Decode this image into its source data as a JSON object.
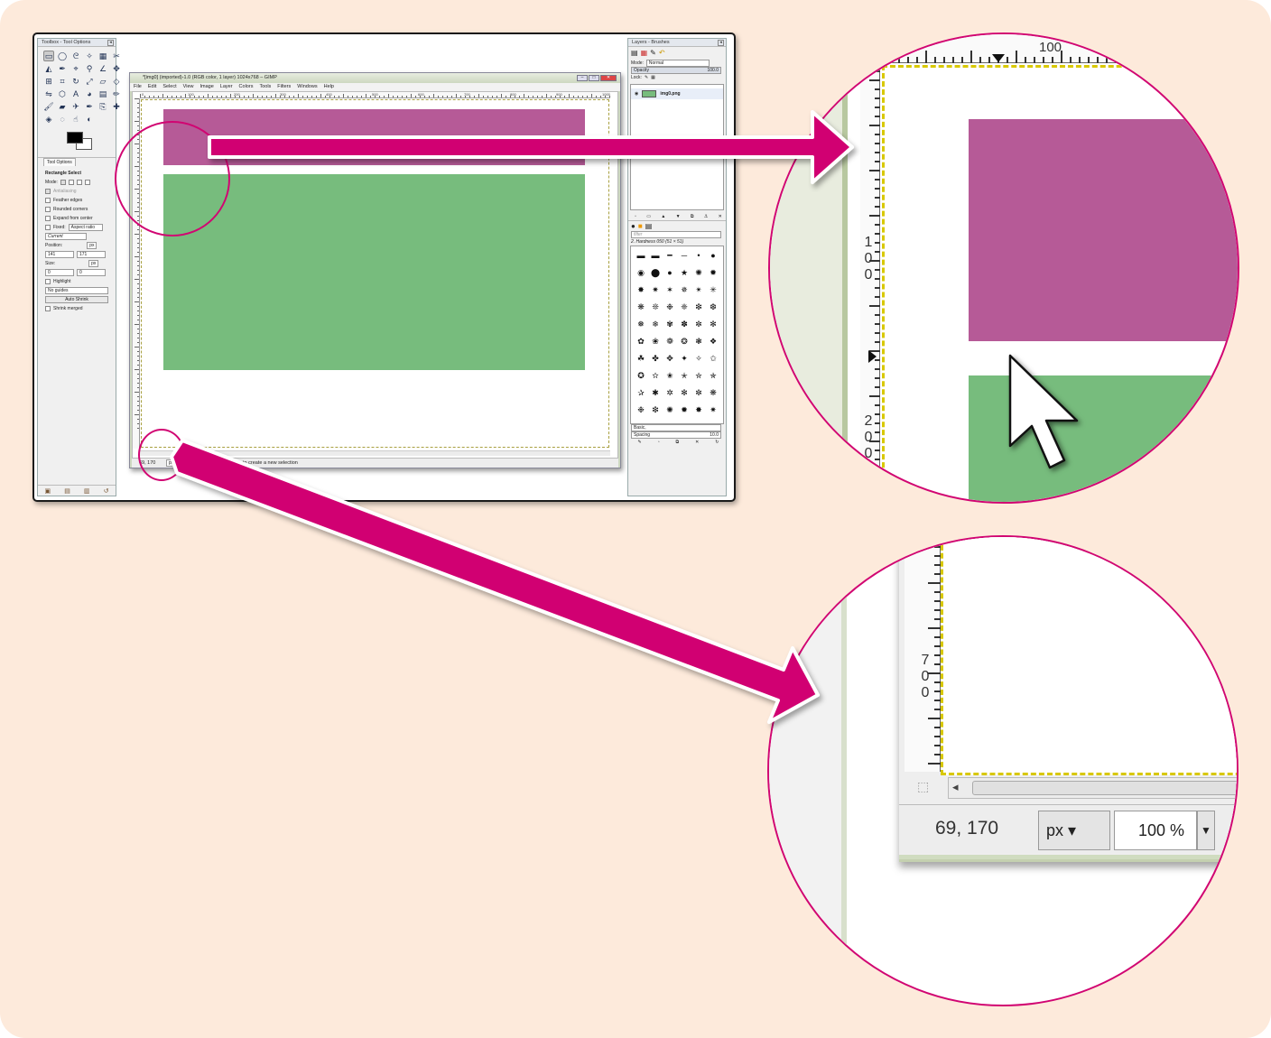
{
  "screen": {
    "toolbox": {
      "title": "Toolbox - Tool Options",
      "tools": [
        "rect-select",
        "ellipse-select",
        "free-select",
        "fuzzy-select",
        "by-color-select",
        "scissors",
        "foreground-select",
        "paths",
        "color-picker",
        "zoom",
        "measure",
        "move",
        "align",
        "crop",
        "rotate",
        "scale",
        "shear",
        "perspective",
        "flip",
        "cage",
        "text",
        "bucket",
        "blend",
        "pencil",
        "paintbrush",
        "eraser",
        "airbrush",
        "ink",
        "clone",
        "heal",
        "perspective-clone",
        "blur",
        "smudge",
        "dodge"
      ],
      "tab_label": "Tool Options",
      "options": {
        "heading": "Rectangle Select",
        "mode_label": "Mode:",
        "antialiasing": "Antialiasing",
        "feather": "Feather edges",
        "rounded": "Rounded corners",
        "expand": "Expand from center",
        "fixed_label": "Fixed:",
        "fixed_value": "Aspect ratio",
        "current": "Current",
        "position_label": "Position:",
        "pos_unit": "px",
        "pos_x": "141",
        "pos_y": "171",
        "size_label": "Size:",
        "size_unit": "px",
        "size_w": "0",
        "size_h": "0",
        "highlight": "Highlight",
        "guides": "No guides",
        "auto_shrink": "Auto Shrink",
        "shrink_merged": "Shrink merged"
      }
    },
    "image_window": {
      "title": "*[img0] (imported)-1.0 (RGB color, 1 layer) 1024x768 – GIMP",
      "menu": [
        "File",
        "Edit",
        "Select",
        "View",
        "Image",
        "Layer",
        "Colors",
        "Tools",
        "Filters",
        "Windows",
        "Help"
      ],
      "ruler_labels": [
        "0",
        "100",
        "200",
        "300",
        "400",
        "500",
        "600",
        "700",
        "800",
        "900",
        "1000"
      ],
      "status": {
        "coords": "69, 170",
        "unit": "px",
        "zoom": "100 %",
        "message": "Click-Drag to create a new selection"
      },
      "colors": {
        "pink": "#b65a97",
        "green": "#77bc7d"
      }
    },
    "layers_panel": {
      "title": "Layers - Brushes",
      "mode_label": "Mode:",
      "mode_value": "Normal",
      "opacity_label": "Opacity",
      "opacity_value": "100.0",
      "lock_label": "Lock:",
      "layer_name": "img0.png",
      "brush_filter": "filter",
      "brush_name": "2. Hardness 050 (51 × 51)",
      "brush_preset": "Basic,",
      "spacing_label": "Spacing",
      "spacing_value": "10.0"
    }
  },
  "zoom_top": {
    "ruler_top": "100",
    "ruler_left_a": [
      "1",
      "0",
      "0"
    ],
    "ruler_left_b": [
      "2",
      "0",
      "0"
    ]
  },
  "zoom_bottom": {
    "ruler_left": [
      "7",
      "0",
      "0"
    ],
    "coords": "69, 170",
    "unit": "px",
    "zoom": "100 %"
  },
  "accent_color": "#d10572"
}
